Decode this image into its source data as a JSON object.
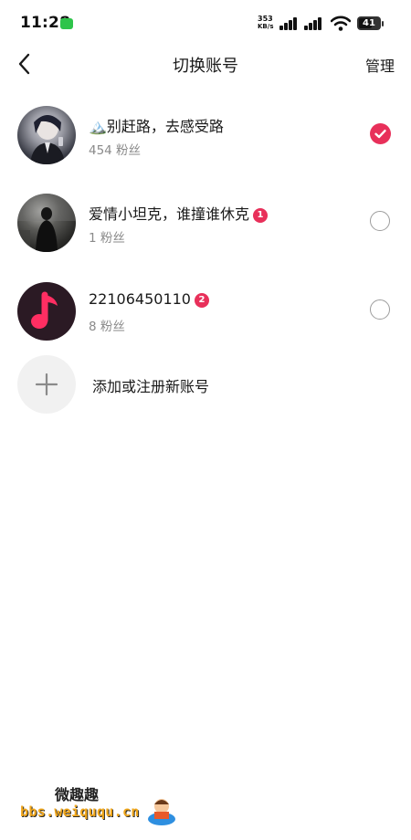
{
  "status_bar": {
    "time": "11:28",
    "net_speed_value": "353",
    "net_speed_unit": "KB/s",
    "battery": "41"
  },
  "header": {
    "title": "切换账号",
    "manage_label": "管理"
  },
  "accounts": [
    {
      "name": "🏔️别赶路，去感受路",
      "fans": "454 粉丝",
      "badge": "",
      "selected": true
    },
    {
      "name": "爱情小坦克，谁撞谁休克",
      "fans": "1 粉丝",
      "badge": "1",
      "selected": false
    },
    {
      "name": "22106450110",
      "fans": "8 粉丝",
      "badge": "2",
      "selected": false
    }
  ],
  "add_account": {
    "label": "添加或注册新账号"
  },
  "watermark": {
    "title": "微趣趣",
    "url": "bbs.weiququ.cn"
  },
  "colors": {
    "accent": "#e8305a",
    "secondary_text": "#8a8a8a",
    "add_circle_bg": "#f1f1f1"
  },
  "icons": {
    "back": "chevron-left-icon",
    "selected": "check-circle-icon",
    "unselected": "radio-empty-icon",
    "add": "plus-icon",
    "app_logo": "music-note-icon"
  }
}
